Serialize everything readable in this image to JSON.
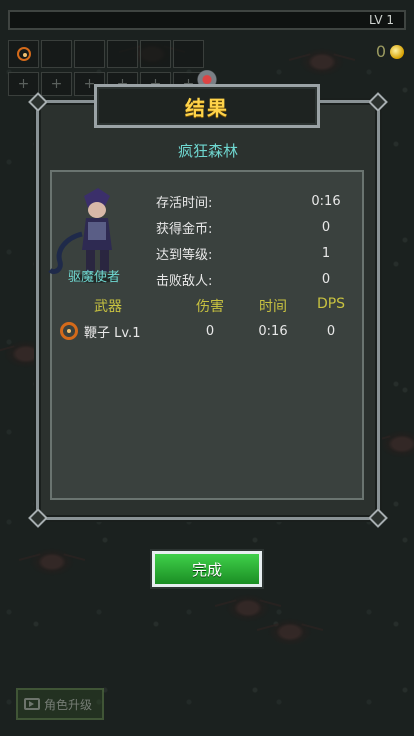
{
  "hud": {
    "level_label": "LV 1",
    "gold_count": "0",
    "slots_row1": [
      "",
      "",
      "",
      "",
      "",
      ""
    ],
    "slots_row2": [
      "+",
      "+",
      "+",
      "+",
      "+",
      "+"
    ]
  },
  "dialog": {
    "title": "结果",
    "stage_name": "疯狂森林",
    "character_name": "驱魔使者",
    "stats": [
      {
        "label": "存活时间:",
        "value": "0:16"
      },
      {
        "label": "获得金币:",
        "value": "0"
      },
      {
        "label": "达到等级:",
        "value": "1"
      },
      {
        "label": "击败敌人:",
        "value": "0"
      }
    ],
    "weapon_table": {
      "headers": [
        "武器",
        "伤害",
        "时间",
        "DPS"
      ],
      "rows": [
        {
          "icon": "whip-icon",
          "name": "鞭子 Lv.1",
          "damage": "0",
          "time": "0:16",
          "dps": "0"
        }
      ]
    },
    "done_button": "完成"
  },
  "bottom": {
    "upgrade_button": "角色升级"
  },
  "colors": {
    "accent_title": "#ffd34a",
    "accent_cyan": "#6fd7d0",
    "header_yellow": "#c8c240",
    "button_green": "#2db538"
  }
}
